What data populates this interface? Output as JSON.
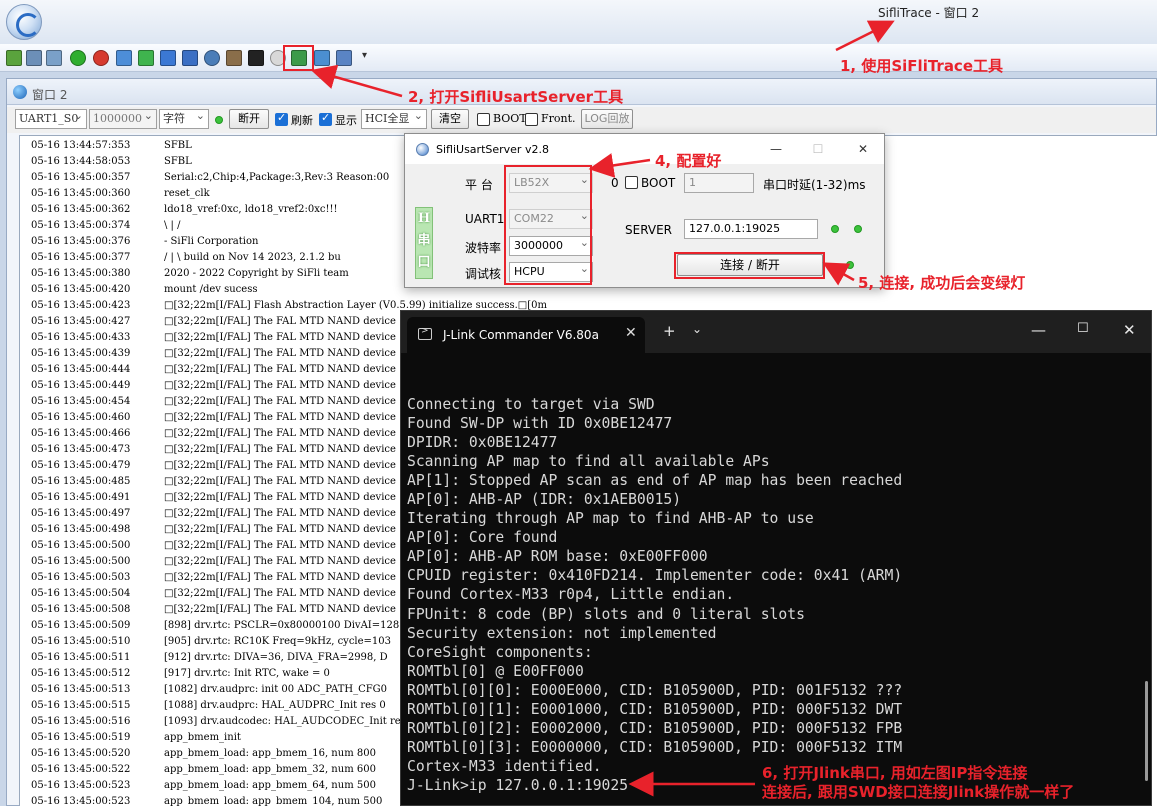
{
  "app": {
    "title": "SifliTrace - 窗口 2"
  },
  "child_window": {
    "title": "窗口 2"
  },
  "controls": {
    "port": "UART1_S0",
    "baud": "1000000",
    "encoding": "字符",
    "disconnect_label": "断开",
    "refresh_label": "刷新",
    "display_label": "显示",
    "hci_label": "HCI全显",
    "clear_label": "清空",
    "boot_label": "BOOT",
    "front_label": "Front.",
    "log_replay_label": "LOG回放"
  },
  "log": [
    {
      "t": "05-16 13:44:57:353",
      "m": "SFBL"
    },
    {
      "t": "05-16 13:44:58:053",
      "m": "SFBL"
    },
    {
      "t": "05-16 13:45:00:357",
      "m": "Serial:c2,Chip:4,Package:3,Rev:3 Reason:00"
    },
    {
      "t": "05-16 13:45:00:360",
      "m": "reset_clk"
    },
    {
      "t": "05-16 13:45:00:362",
      "m": "ldo18_vref:0xc, ldo18_vref2:0xc!!!"
    },
    {
      "t": "05-16 13:45:00:374",
      "m": " \\ | /"
    },
    {
      "t": "05-16 13:45:00:376",
      "m": "- SiFli Corporation"
    },
    {
      "t": "05-16 13:45:00:377",
      "m": " / | \\     build on Nov 14 2023, 2.1.2 bu"
    },
    {
      "t": "05-16 13:45:00:380",
      "m": " 2020 - 2022 Copyright by SiFli team"
    },
    {
      "t": "05-16 13:45:00:420",
      "m": "mount /dev sucess"
    },
    {
      "t": "05-16 13:45:00:423",
      "m": "□[32;22m[I/FAL] Flash Abstraction Layer (V0.5.99) initialize success.□[0m"
    },
    {
      "t": "05-16 13:45:00:427",
      "m": "□[32;22m[I/FAL] The FAL MTD NAND device"
    },
    {
      "t": "05-16 13:45:00:433",
      "m": "□[32;22m[I/FAL] The FAL MTD NAND device"
    },
    {
      "t": "05-16 13:45:00:439",
      "m": "□[32;22m[I/FAL] The FAL MTD NAND device"
    },
    {
      "t": "05-16 13:45:00:444",
      "m": "□[32;22m[I/FAL] The FAL MTD NAND device"
    },
    {
      "t": "05-16 13:45:00:449",
      "m": "□[32;22m[I/FAL] The FAL MTD NAND device"
    },
    {
      "t": "05-16 13:45:00:454",
      "m": "□[32;22m[I/FAL] The FAL MTD NAND device"
    },
    {
      "t": "05-16 13:45:00:460",
      "m": "□[32;22m[I/FAL] The FAL MTD NAND device"
    },
    {
      "t": "05-16 13:45:00:466",
      "m": "□[32;22m[I/FAL] The FAL MTD NAND device"
    },
    {
      "t": "05-16 13:45:00:473",
      "m": "□[32;22m[I/FAL] The FAL MTD NAND device"
    },
    {
      "t": "05-16 13:45:00:479",
      "m": "□[32;22m[I/FAL] The FAL MTD NAND device"
    },
    {
      "t": "05-16 13:45:00:485",
      "m": "□[32;22m[I/FAL] The FAL MTD NAND device"
    },
    {
      "t": "05-16 13:45:00:491",
      "m": "□[32;22m[I/FAL] The FAL MTD NAND device"
    },
    {
      "t": "05-16 13:45:00:497",
      "m": "□[32;22m[I/FAL] The FAL MTD NAND device"
    },
    {
      "t": "05-16 13:45:00:498",
      "m": "□[32;22m[I/FAL] The FAL MTD NAND device"
    },
    {
      "t": "05-16 13:45:00:500",
      "m": "□[32;22m[I/FAL] The FAL MTD NAND device"
    },
    {
      "t": "05-16 13:45:00:500",
      "m": "□[32;22m[I/FAL] The FAL MTD NAND device"
    },
    {
      "t": "05-16 13:45:00:503",
      "m": "□[32;22m[I/FAL] The FAL MTD NAND device"
    },
    {
      "t": "05-16 13:45:00:504",
      "m": "□[32;22m[I/FAL] The FAL MTD NAND device"
    },
    {
      "t": "05-16 13:45:00:508",
      "m": "□[32;22m[I/FAL] The FAL MTD NAND device"
    },
    {
      "t": "05-16 13:45:00:509",
      "m": "[898] drv.rtc: PSCLR=0x80000100 DivAI=128"
    },
    {
      "t": "05-16 13:45:00:510",
      "m": "[905] drv.rtc: RC10K Freq=9kHz, cycle=103"
    },
    {
      "t": "05-16 13:45:00:511",
      "m": "[912] drv.rtc: DIVA=36, DIVA_FRA=2998, D"
    },
    {
      "t": "05-16 13:45:00:512",
      "m": "[917] drv.rtc: Init RTC, wake = 0"
    },
    {
      "t": "05-16 13:45:00:513",
      "m": "[1082] drv.audprc: init 00 ADC_PATH_CFG0"
    },
    {
      "t": "05-16 13:45:00:515",
      "m": "[1088] drv.audprc: HAL_AUDPRC_Init res 0"
    },
    {
      "t": "05-16 13:45:00:516",
      "m": "[1093] drv.audcodec: HAL_AUDCODEC_Init re"
    },
    {
      "t": "05-16 13:45:00:519",
      "m": "app_bmem_init"
    },
    {
      "t": "05-16 13:45:00:520",
      "m": "app_bmem_load: app_bmem_16, num 800"
    },
    {
      "t": "05-16 13:45:00:522",
      "m": "app_bmem_load: app_bmem_32, num 600"
    },
    {
      "t": "05-16 13:45:00:523",
      "m": "app_bmem_load: app_bmem_64, num 500"
    },
    {
      "t": "05-16 13:45:00:523",
      "m": "app_bmem_load: app_bmem_104, num 500"
    }
  ],
  "usart_server": {
    "title": "SifliUsartServer v2.8",
    "platform_label": "平  台",
    "platform_value": "LB52X",
    "zero_label": "0",
    "boot_label": "BOOT",
    "delay_value": "1",
    "delay_label": "串口时延(1-32)ms",
    "badge_chars": [
      "H",
      "串",
      "口"
    ],
    "uart_label": "UART1",
    "uart_value": "COM22",
    "baud_label": "波特率",
    "baud_value": "3000000",
    "core_label": "调试核",
    "core_value": "HCPU",
    "server_label": "SERVER",
    "server_value": "127.0.0.1:19025",
    "connect_label": "连接 / 断开"
  },
  "jlink": {
    "tab_title": "J-Link Commander V6.80a",
    "lines": [
      "Connecting to target via SWD",
      "Found SW-DP with ID 0x0BE12477",
      "DPIDR: 0x0BE12477",
      "Scanning AP map to find all available APs",
      "AP[1]: Stopped AP scan as end of AP map has been reached",
      "AP[0]: AHB-AP (IDR: 0x1AEB0015)",
      "Iterating through AP map to find AHB-AP to use",
      "AP[0]: Core found",
      "AP[0]: AHB-AP ROM base: 0xE00FF000",
      "CPUID register: 0x410FD214. Implementer code: 0x41 (ARM)",
      "Found Cortex-M33 r0p4, Little endian.",
      "FPUnit: 8 code (BP) slots and 0 literal slots",
      "Security extension: not implemented",
      "CoreSight components:",
      "ROMTbl[0] @ E00FF000",
      "ROMTbl[0][0]: E000E000, CID: B105900D, PID: 001F5132 ???",
      "ROMTbl[0][1]: E0001000, CID: B105900D, PID: 000F5132 DWT",
      "ROMTbl[0][2]: E0002000, CID: B105900D, PID: 000F5132 FPB",
      "ROMTbl[0][3]: E0000000, CID: B105900D, PID: 000F5132 ITM",
      "Cortex-M33 identified.",
      "J-Link>ip 127.0.0.1:19025"
    ]
  },
  "annotations": {
    "step1": "1, 使用SiFliTrace工具",
    "step2": "2, 打开SifliUsartServer工具",
    "step4": "4, 配置好",
    "step5": "5, 连接, 成功后会变绿灯",
    "step6a": "6, 打开Jlink串口, 用如左图IP指令连接",
    "step6b": "连接后, 跟用SWD接口连接Jlink操作就一样了"
  },
  "colors": {
    "annotation": "#e8222b",
    "led_on": "#3cc23c",
    "terminal_bg": "#0c0c0c"
  }
}
